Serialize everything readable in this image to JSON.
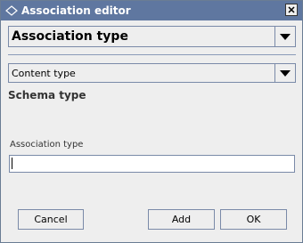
{
  "window": {
    "title": "Association editor",
    "icon": "diamond-app-icon",
    "close_icon": "close-icon"
  },
  "association_type_combo": {
    "value": "Association type",
    "arrow_icon": "triangle-down-icon"
  },
  "content_type_combo": {
    "value": "Content type",
    "arrow_icon": "triangle-down-icon"
  },
  "schema_type_label": "Schema type",
  "association_type_field": {
    "label": "Association type",
    "value": ""
  },
  "buttons": {
    "cancel": "Cancel",
    "add": "Add",
    "ok": "OK"
  },
  "colors": {
    "titlebar": "#5f77a0",
    "background": "#eeeeee",
    "border": "#7a8aa8"
  }
}
